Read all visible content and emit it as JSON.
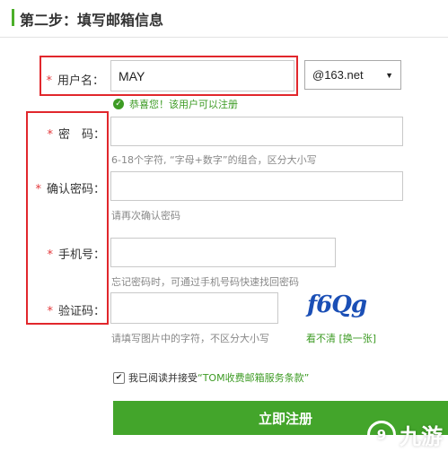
{
  "step": {
    "title": "第二步：填写邮箱信息"
  },
  "form": {
    "username": {
      "label": "用户名：",
      "value": "MAY",
      "success_hint": "恭喜您！该用户可以注册"
    },
    "domain_select": {
      "value": "@163.net"
    },
    "password": {
      "label": "密　码：",
      "hint": "6-18个字符, “字母+数字”的组合，区分大小写"
    },
    "confirm_password": {
      "label": "确认密码：",
      "hint": "请再次确认密码"
    },
    "phone": {
      "label": "手机号：",
      "hint": "忘记密码时，可通过手机号码快速找回密码"
    },
    "captcha": {
      "label": "验证码：",
      "hint": "请填写图片中的字符，不区分大小写",
      "image_text": "f6Qg",
      "refresh_link": "看不清 [换一张]"
    },
    "required_mark": "*",
    "agree": {
      "text": "我已阅读并接受",
      "terms_link": "“TOM收费邮箱服务条款”",
      "checked": true
    },
    "submit_label": "立即注册"
  },
  "watermark": {
    "text": "九游"
  },
  "colors": {
    "accent": "#43a52b",
    "error_outline": "#e1272c",
    "captcha": "#1b4fb6"
  }
}
